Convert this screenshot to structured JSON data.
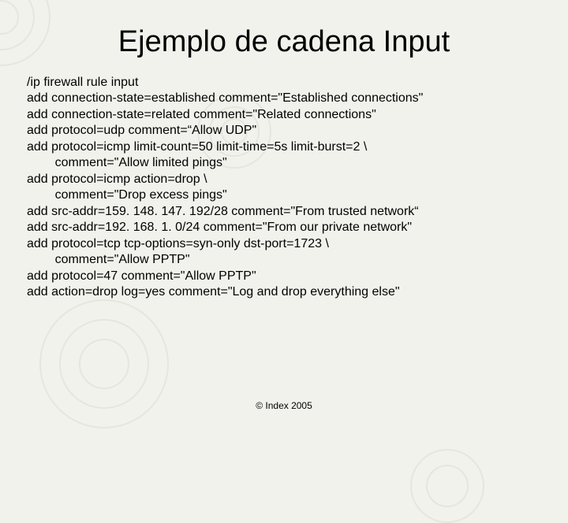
{
  "title": "Ejemplo de cadena Input",
  "code": "/ip firewall rule input\nadd connection-state=established comment=\"Established connections\"\nadd connection-state=related comment=\"Related connections\"\nadd protocol=udp comment=“Allow UDP\"\nadd protocol=icmp limit-count=50 limit-time=5s limit-burst=2 \\\n        comment=\"Allow limited pings\"\nadd protocol=icmp action=drop \\\n        comment=\"Drop excess pings\"\nadd src-addr=159. 148. 147. 192/28 comment=\"From trusted network“\nadd src-addr=192. 168. 1. 0/24 comment=\"From our private network\"\nadd protocol=tcp tcp-options=syn-only dst-port=1723 \\\n        comment=\"Allow PPTP\"\nadd protocol=47 comment=\"Allow PPTP\"\nadd action=drop log=yes comment=\"Log and drop everything else\"",
  "footer": "© Index 2005"
}
